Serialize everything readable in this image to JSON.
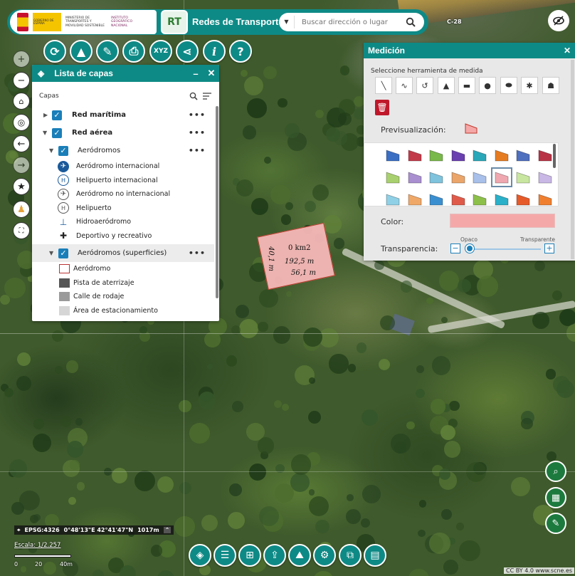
{
  "header": {
    "gov_logo_text": "GOBIERNO DE ESPAÑA",
    "ministry_text": "MINISTERIO DE TRANSPORTES Y MOVILIDAD SOSTENIBLE",
    "institute_text": "INSTITUTO GEOGRÁFICO NACIONAL",
    "app_title": "Redes de Transporte",
    "search_placeholder": "Buscar dirección o lugar",
    "road_label": "C-28"
  },
  "toolbar": {
    "icons": [
      "refresh-icon",
      "warning-icon",
      "ruler-icon",
      "print-icon",
      "xyz-icon",
      "share-icon",
      "info-icon",
      "help-icon"
    ],
    "xyz_label": "XYZ",
    "info_label": "i",
    "help_label": "?"
  },
  "nav": {
    "zoom_in": "+",
    "zoom_out": "−",
    "icons": [
      "home-icon",
      "locate-icon",
      "arrow-left-icon",
      "arrow-right-icon",
      "star-icon",
      "pegman-icon",
      "fullscreen-icon"
    ]
  },
  "layers": {
    "title": "Lista de capas",
    "subheader": "Capas",
    "groups": [
      {
        "label": "Red marítima",
        "checked": true,
        "expanded": false
      },
      {
        "label": "Red aérea",
        "checked": true,
        "expanded": true
      }
    ],
    "sublayer1": {
      "label": "Aeródromos",
      "checked": true,
      "legend": [
        {
          "label": "Aeródromo internacional",
          "icon": "plane-filled-icon"
        },
        {
          "label": "Helipuerto internacional",
          "icon": "heliport-circle-icon"
        },
        {
          "label": "Aeródromo no internacional",
          "icon": "plane-outline-icon"
        },
        {
          "label": "Helipuerto",
          "icon": "heliport-icon"
        },
        {
          "label": "Hidroaeródromo",
          "icon": "seaplane-icon"
        },
        {
          "label": "Deportivo y recreativo",
          "icon": "light-plane-icon"
        }
      ]
    },
    "sublayer2": {
      "label": "Aeródromos (superficies)",
      "checked": true,
      "legend": [
        {
          "label": "Aeródromo",
          "color": "#ffffff",
          "border": "#b33"
        },
        {
          "label": "Pista de aterrizaje",
          "color": "#555555",
          "border": "#555555"
        },
        {
          "label": "Calle de rodaje",
          "color": "#9a9a9a",
          "border": "#9a9a9a"
        },
        {
          "label": "Área de estacionamiento",
          "color": "#d6d6d6",
          "border": "#d6d6d6"
        }
      ]
    }
  },
  "measurement": {
    "title": "Medición",
    "instructions": "Seleccione herramienta de medida",
    "tools": [
      "line-icon",
      "polyline-icon",
      "freehand-icon",
      "triangle-icon",
      "rectangle-icon",
      "circle-icon",
      "ellipse-icon",
      "polygon-icon",
      "freehand-polygon-icon"
    ],
    "preview_label": "Previsualización:",
    "color_label": "Color:",
    "color_value": "#f5a8a8",
    "transparency_label": "Transparencia:",
    "opaque_label": "Opaco",
    "transparent_label": "Transparente",
    "transparency_value": 0,
    "palette": [
      "#3a6fc4",
      "#c23b4a",
      "#79b84a",
      "#6a3fb0",
      "#2aa7b8",
      "#e67c22",
      "#4f6fbf",
      "#b83346",
      "#a9d06e",
      "#a98fd0",
      "#7fc3dd",
      "#eba56a",
      "#a8c0ea",
      "#f0a8b0",
      "#c8e6a0",
      "#c9b8e6",
      "#8fd0e6",
      "#f0a868",
      "#3a8fd0",
      "#e05a4a",
      "#8cc04a",
      "#2ab0c8",
      "#e65a2a",
      "#f08030"
    ],
    "selected_swatch": "#f0a8b0"
  },
  "map": {
    "area": "0 km2",
    "perimeter": "192,5 m",
    "side_a": "56,1 m",
    "side_b": "40,1 m"
  },
  "status": {
    "crs": "EPSG:4326",
    "coords": "0°48'13\"E 42°41'47\"N",
    "elevation": "1017m",
    "scale": "Escala: 1/2.257",
    "scale_ticks": [
      "0",
      "20",
      "40m"
    ],
    "attribution": "CC BY 4.0 www.scne.es"
  },
  "bottom_bar": {
    "icons": [
      "layers-icon",
      "list-icon",
      "grid-icon",
      "upload-map-icon",
      "terrain-icon",
      "network-icon",
      "split-view-icon",
      "basemap-icon"
    ]
  },
  "right_controls": {
    "icons": [
      "zoom-map-icon",
      "table-icon",
      "ruler-edit-icon"
    ]
  }
}
